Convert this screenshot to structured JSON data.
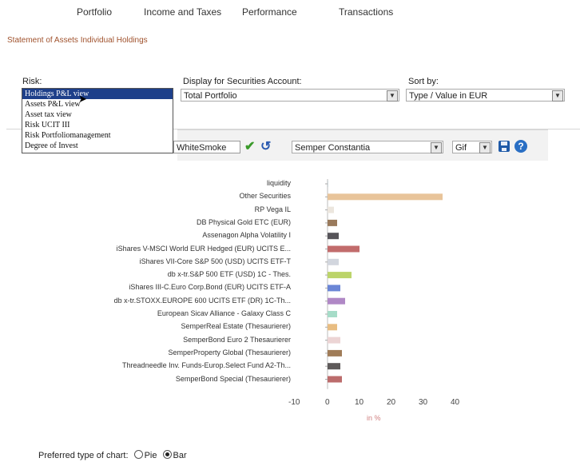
{
  "nav": {
    "items": [
      "Portfolio",
      "Income and Taxes",
      "Performance",
      "Transactions"
    ]
  },
  "breadcrumb": "Statement of Assets Individual Holdings",
  "risk": {
    "label": "Risk:",
    "options": [
      "Holdings P&L view",
      "Assets P&L view",
      "Asset tax view",
      "Risk UCIT III",
      "Risk Portfoliomanagement",
      "Degree of Invest"
    ],
    "selected_index": 0
  },
  "display_account": {
    "label": "Display for Securities Account:",
    "value": "Total Portfolio"
  },
  "sort_by": {
    "label": "Sort by:",
    "value": "Type / Value in EUR"
  },
  "toolbar": {
    "color_value": "WhiteSmoke",
    "theme_value": "Semper Constantia",
    "format_value": "Gif"
  },
  "chart_data": {
    "type": "bar",
    "orientation": "horizontal",
    "xlabel": "in %",
    "xlim": [
      -10,
      40
    ],
    "xticks": [
      "-10",
      "0",
      "10",
      "20",
      "30",
      "40"
    ],
    "categories": [
      "liquidity",
      "Other Securities",
      "RP Vega IL",
      "DB Physical Gold ETC (EUR)",
      "Assenagon Alpha Volatility I",
      "iShares V-MSCI World EUR Hedged (EUR) UCITS E...",
      "iShares VII-Core S&P 500 (USD) UCITS ETF-T",
      "db x-tr.S&P 500 ETF (USD) 1C - Thes.",
      "iShares III-C.Euro Corp.Bond (EUR) UCITS ETF-A",
      "db x-tr.STOXX.EUROPE 600 UCITS ETF (DR) 1C-Th...",
      "European Sicav Alliance - Galaxy Class C",
      "SemperReal Estate (Thesaurierer)",
      "SemperBond Euro 2 Thesaurierer",
      "SemperProperty Global (Thesaurierer)",
      "Threadneedle Inv. Funds-Europ.Select Fund A2-Th...",
      "SemperBond Special (Thesaurierer)"
    ],
    "values": [
      0.2,
      36,
      2,
      3,
      3.5,
      10,
      3.5,
      7.5,
      4,
      5.5,
      3,
      3,
      4,
      4.5,
      4,
      4.5
    ],
    "colors": [
      "#cfd8dc",
      "#e8c49a",
      "#ece6de",
      "#9a7a5c",
      "#57555a",
      "#c26c6c",
      "#d2d6de",
      "#bcd46a",
      "#6b86d6",
      "#b088c6",
      "#a6dcc8",
      "#e8bd82",
      "#ecd4d4",
      "#a07c58",
      "#5e5a5a",
      "#bc6c6c"
    ]
  },
  "chart_type_pref": {
    "label": "Preferred type of chart:",
    "options": [
      "Pie",
      "Bar"
    ],
    "selected": "Bar"
  }
}
